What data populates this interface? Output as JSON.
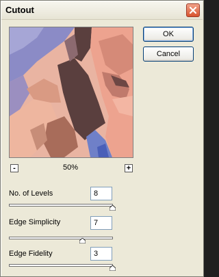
{
  "window": {
    "title": "Cutout"
  },
  "preview": {
    "zoom": "50%",
    "zoom_out_symbol": "-",
    "zoom_in_symbol": "+"
  },
  "buttons": {
    "ok": "OK",
    "cancel": "Cancel"
  },
  "params": [
    {
      "label": "No. of Levels",
      "value": "8",
      "slider_fraction": 1.0
    },
    {
      "label": "Edge Simplicity",
      "value": "7",
      "slider_fraction": 0.7
    },
    {
      "label": "Edge Fidelity",
      "value": "3",
      "slider_fraction": 1.0
    }
  ],
  "colors": {
    "dialog_bg": "#ece9d8",
    "close_button": "#d8532e",
    "accent_border": "#003c74"
  }
}
